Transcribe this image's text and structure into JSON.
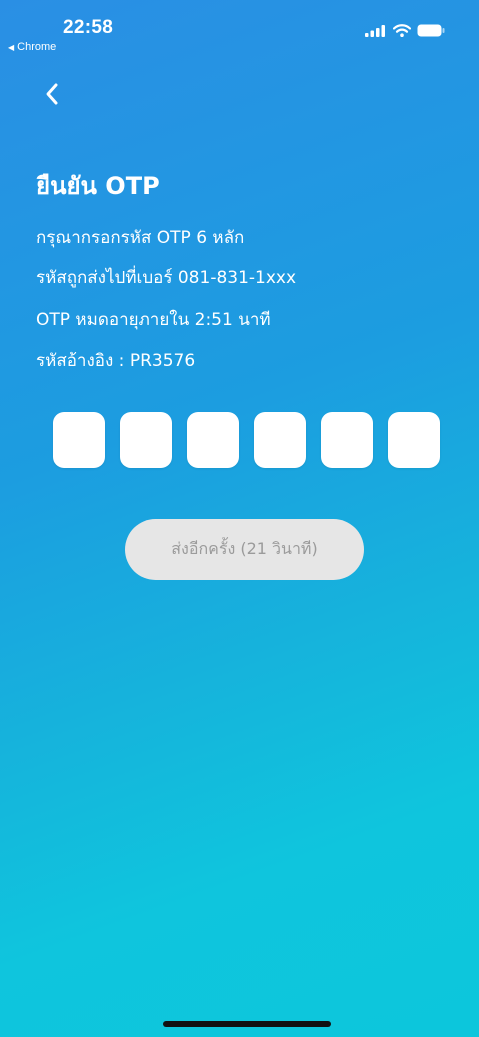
{
  "status_bar": {
    "time": "22:58",
    "back_app_label": "Chrome",
    "icons": [
      "signal-icon",
      "wifi-icon",
      "battery-icon"
    ]
  },
  "header": {
    "back_icon": "chevron-left-icon"
  },
  "main": {
    "title": "ยืนยัน OTP",
    "lines": [
      "กรุณากรอกรหัส OTP 6 หลัก",
      "รหัสถูกส่งไปที่เบอร์ 081-831-1xxx",
      "OTP หมดอายุภายใน 2:51 นาที",
      "รหัสอ้างอิง : PR3576"
    ],
    "otp_digits": [
      "",
      "",
      "",
      "",
      "",
      ""
    ],
    "resend_label": "ส่งอีกครั้ง (21 วินาที)"
  },
  "colors": {
    "background_start": "#2a8fe4",
    "background_end": "#0cc6dc",
    "otp_box": "#ffffff",
    "resend_button_bg": "#e6e6e6",
    "resend_button_text": "#9b9b9b"
  }
}
